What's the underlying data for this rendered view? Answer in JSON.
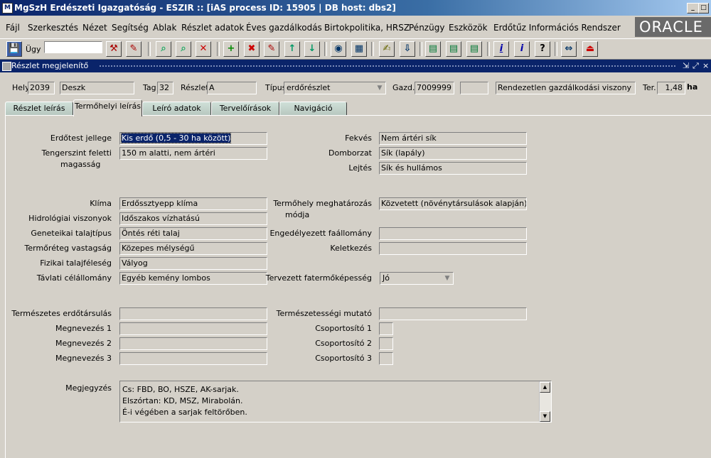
{
  "window": {
    "title": "MgSzH Erdészeti Igazgatóság - ESZIR :: [iAS process ID: 15905 | DB host: dbs2]",
    "controls": [
      "_",
      "□",
      "×"
    ]
  },
  "menu": [
    "Fájl",
    "Szerkesztés",
    "Nézet",
    "Segítség",
    "Ablak",
    "Részlet adatok",
    "Éves gazdálkodás",
    "Birtokpolitika, HRSZ",
    "Pénzügy",
    "Eszközök",
    "Erdőtűz Információs Rendszer"
  ],
  "brand": "ORACLE",
  "toolbar": {
    "ugy_label": "Ügy",
    "ugy_value": "",
    "icons": [
      "save-icon",
      "hammer-icon",
      "brush-icon",
      "find-icon",
      "find-next-icon",
      "no-find-icon",
      "insert-record-icon",
      "delete-record-icon",
      "edit-record-icon",
      "previous-record-icon",
      "next-record-icon",
      "globe-icon",
      "chart-icon",
      "edit-pen-icon",
      "export-icon",
      "table1-icon",
      "table2-icon",
      "table3-icon",
      "info-underline-icon",
      "info-icon",
      "help-icon",
      "navigate-icon",
      "exit-icon"
    ],
    "glyphs": [
      "💾",
      "⚒",
      "✎",
      "⌕",
      "⌕",
      "✕",
      "+",
      "✖",
      "✎",
      "↑",
      "↓",
      "◉",
      "▦",
      "✍",
      "⇩",
      "▤",
      "▤",
      "▤",
      "i",
      "i",
      "?",
      "⇔",
      "⏏"
    ]
  },
  "inner_window": {
    "title": "Részlet megjelenítő",
    "controls": [
      "⇲",
      "⤢",
      "×"
    ]
  },
  "header": {
    "hely_label": "Hely",
    "hely_value": "2039",
    "name_value": "Deszk",
    "tag_label": "Tag",
    "tag_value": "32",
    "reszlet_label": "Részlet",
    "reszlet_value": "A",
    "tipus_label": "Típus",
    "tipus_value": "erdőrészlet",
    "gazd_label": "Gazd.",
    "gazd_value": "7009999",
    "gazd_extra": "",
    "gazd_desc": "Rendezetlen gazdálkodási viszony",
    "ter_label": "Ter.",
    "ter_value": "1,48",
    "ter_unit": "ha"
  },
  "tabs": [
    {
      "label": "Részlet leírás",
      "active": false
    },
    {
      "label": "Termőhelyi leírás",
      "active": true
    },
    {
      "label": "Leíró adatok",
      "active": false
    },
    {
      "label": "Tervelőírások",
      "active": false
    },
    {
      "label": "Navigáció",
      "active": false
    }
  ],
  "form": {
    "erdotest_label": "Erdőtest jellege",
    "erdotest_value": "Kis erdő (0,5 - 30 ha között)",
    "tengerszint_label1": "Tengerszint feletti",
    "tengerszint_label2": "magasság",
    "tengerszint_value": "150 m alatti, nem ártéri",
    "fekves_label": "Fekvés",
    "fekves_value": "Nem ártéri sík",
    "domborzat_label": "Domborzat",
    "domborzat_value": "Sík (lapály)",
    "lejtes_label": "Lejtés",
    "lejtes_value": "Sík és hullámos",
    "klima_label": "Klíma",
    "klima_value": "Erdőssztyepp klíma",
    "hidro_label": "Hidrológiai viszonyok",
    "hidro_value": "Időszakos vízhatású",
    "genetikai_label": "Geneteikai talajtípus",
    "genetikai_value": "Öntés réti talaj",
    "termoreteg_label": "Termőréteg vastagság",
    "termoreteg_value": "Közepes mélységű",
    "fizikai_label": "Fizikai talajféleség",
    "fizikai_value": "Vályog",
    "tavlati_label": "Távlati célállomány",
    "tavlati_value": "Egyéb kemény lombos",
    "meghatarozas_label1": "Termőhely meghatározás",
    "meghatarozas_label2": "módja",
    "meghatarozas_value": "Közvetett (növénytársulások alapján)",
    "engedelyezett_label": "Engedélyezett faállomány",
    "engedelyezett_value": "",
    "keletkezes_label": "Keletkezés",
    "keletkezes_value": "",
    "tervezett_label": "Tervezett fatermőképesség",
    "tervezett_value": "Jó",
    "termeszetes_label": "Természetes erdőtársulás",
    "termeszetes_value": "",
    "mutato_label": "Természetességi mutató",
    "mutato_value": "",
    "megnevezes1_label": "Megnevezés 1",
    "megnevezes1_value": "",
    "megnevezes2_label": "Megnevezés 2",
    "megnevezes2_value": "",
    "megnevezes3_label": "Megnevezés 3",
    "megnevezes3_value": "",
    "csop1_label": "Csoportosító 1",
    "csop1_value": "",
    "csop2_label": "Csoportosító 2",
    "csop2_value": "",
    "csop3_label": "Csoportosító 3",
    "csop3_value": "",
    "megjegyzes_label": "Megjegyzés",
    "megjegyzes_lines": [
      "Cs: FBD, BO, HSZE, AK-sarjak.",
      "Elszórtan: KD, MSZ, Mirabolán.",
      "É-i végében a sarjak feltörőben."
    ]
  }
}
